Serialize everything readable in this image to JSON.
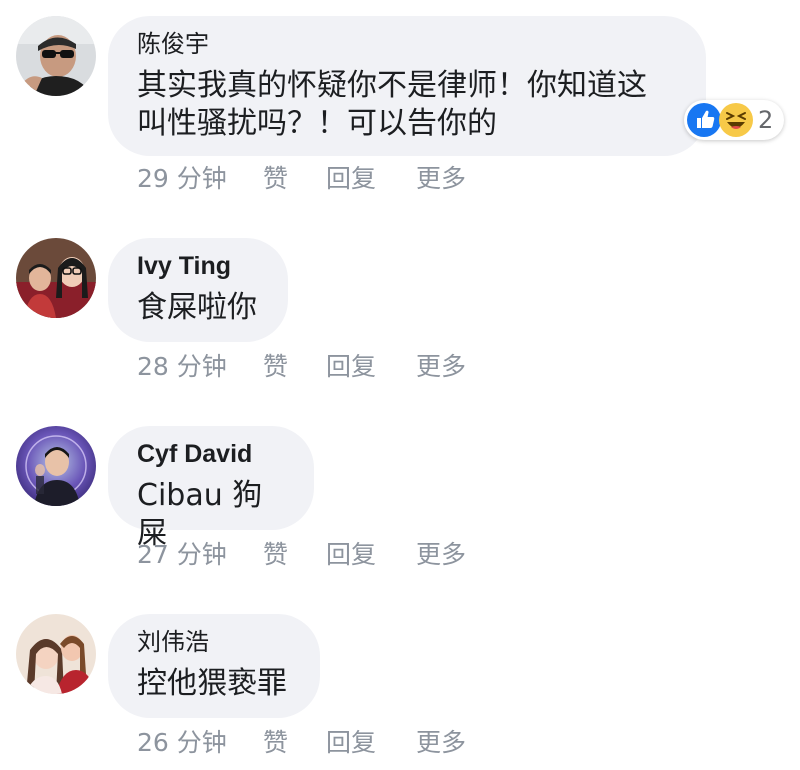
{
  "comments": [
    {
      "author": "陈俊宇",
      "text": "其实我真的怀疑你不是律师！你知道这\n叫性骚扰吗？！可以告你的",
      "time": "29 分钟",
      "like": "赞",
      "reply": "回复",
      "more": "更多",
      "reaction_count": "2",
      "reaction_icons": [
        "like-icon",
        "haha-icon"
      ]
    },
    {
      "author": "Ivy Ting",
      "text": "食屎啦你",
      "time": "28 分钟",
      "like": "赞",
      "reply": "回复",
      "more": "更多"
    },
    {
      "author": "Cyf David",
      "text": "Cibau 狗屎",
      "time": "27 分钟",
      "like": "赞",
      "reply": "回复",
      "more": "更多"
    },
    {
      "author": "刘伟浩",
      "text": "控他猥亵罪",
      "time": "26 分钟",
      "like": "赞",
      "reply": "回复",
      "more": "更多"
    }
  ],
  "colors": {
    "bubble": "#f1f2f6",
    "action_text": "#8d949e",
    "like_blue": "#1877f2",
    "haha_yellow": "#f7c948"
  }
}
